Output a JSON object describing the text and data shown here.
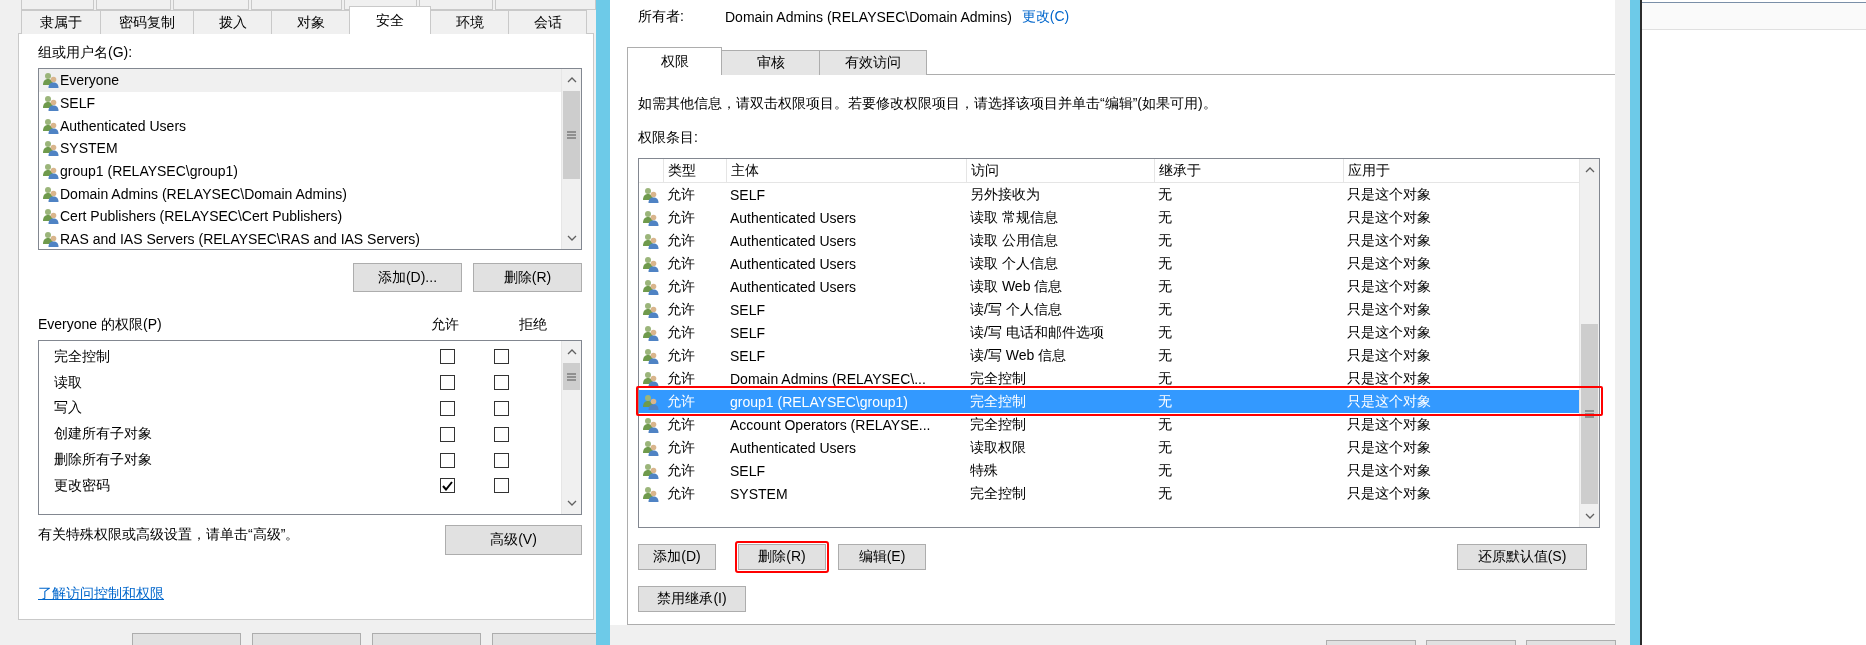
{
  "left_dialog": {
    "tabs": [
      {
        "label": "隶属于",
        "selected": false
      },
      {
        "label": "密码复制",
        "selected": false
      },
      {
        "label": "拨入",
        "selected": false
      },
      {
        "label": "对象",
        "selected": false
      },
      {
        "label": "安全",
        "selected": true
      },
      {
        "label": "环境",
        "selected": false
      },
      {
        "label": "会话",
        "selected": false
      }
    ],
    "group_label": "组或用户名(G):",
    "groups": [
      {
        "name": "Everyone",
        "selected": true
      },
      {
        "name": "SELF",
        "selected": false
      },
      {
        "name": "Authenticated Users",
        "selected": false
      },
      {
        "name": "SYSTEM",
        "selected": false
      },
      {
        "name": "group1 (RELAYSEC\\group1)",
        "selected": false
      },
      {
        "name": "Domain Admins (RELAYSEC\\Domain Admins)",
        "selected": false
      },
      {
        "name": "Cert Publishers (RELAYSEC\\Cert Publishers)",
        "selected": false
      },
      {
        "name": "RAS and IAS Servers (RELAYSEC\\RAS and IAS Servers)",
        "selected": false
      }
    ],
    "group_buttons": [
      "添加(D)...",
      "删除(R)"
    ],
    "permissions_label": "Everyone 的权限(P)",
    "allow_header": "允许",
    "deny_header": "拒绝",
    "permissions": [
      {
        "name": "完全控制",
        "allow": false,
        "deny": false
      },
      {
        "name": "读取",
        "allow": false,
        "deny": false
      },
      {
        "name": "写入",
        "allow": false,
        "deny": false
      },
      {
        "name": "创建所有子对象",
        "allow": false,
        "deny": false
      },
      {
        "name": "删除所有子对象",
        "allow": false,
        "deny": false
      },
      {
        "name": "更改密码",
        "allow": true,
        "deny": false
      }
    ],
    "advanced_hint": "有关特殊权限或高级设置，请单击“高级”。",
    "advanced_button": "高级(V)",
    "learn_link": "了解访问控制和权限"
  },
  "right_dialog": {
    "owner_label": "所有者:",
    "owner": "Domain Admins (RELAYSEC\\Domain Admins)",
    "change_link": "更改(C)",
    "tabs": [
      {
        "label": "权限",
        "selected": true
      },
      {
        "label": "审核",
        "selected": false
      },
      {
        "label": "有效访问",
        "selected": false
      }
    ],
    "info": "如需其他信息，请双击权限项目。若要修改权限项目，请选择该项目并单击“编辑”(如果可用)。",
    "entries_label": "权限条目:",
    "table": {
      "columns": [
        "类型",
        "主体",
        "访问",
        "继承于",
        "应用于"
      ],
      "rows": [
        {
          "type": "允许",
          "principal": "SELF",
          "access": "另外接收为",
          "inherited_from": "无",
          "applies_to": "只是这个对象",
          "selected": false,
          "annotated": false
        },
        {
          "type": "允许",
          "principal": "Authenticated Users",
          "access": "读取 常规信息",
          "inherited_from": "无",
          "applies_to": "只是这个对象",
          "selected": false,
          "annotated": false
        },
        {
          "type": "允许",
          "principal": "Authenticated Users",
          "access": "读取 公用信息",
          "inherited_from": "无",
          "applies_to": "只是这个对象",
          "selected": false,
          "annotated": false
        },
        {
          "type": "允许",
          "principal": "Authenticated Users",
          "access": "读取 个人信息",
          "inherited_from": "无",
          "applies_to": "只是这个对象",
          "selected": false,
          "annotated": false
        },
        {
          "type": "允许",
          "principal": "Authenticated Users",
          "access": "读取 Web 信息",
          "inherited_from": "无",
          "applies_to": "只是这个对象",
          "selected": false,
          "annotated": false
        },
        {
          "type": "允许",
          "principal": "SELF",
          "access": "读/写 个人信息",
          "inherited_from": "无",
          "applies_to": "只是这个对象",
          "selected": false,
          "annotated": false
        },
        {
          "type": "允许",
          "principal": "SELF",
          "access": "读/写 电话和邮件选项",
          "inherited_from": "无",
          "applies_to": "只是这个对象",
          "selected": false,
          "annotated": false
        },
        {
          "type": "允许",
          "principal": "SELF",
          "access": "读/写 Web 信息",
          "inherited_from": "无",
          "applies_to": "只是这个对象",
          "selected": false,
          "annotated": false
        },
        {
          "type": "允许",
          "principal": "Domain Admins (RELAYSEC\\...",
          "access": "完全控制",
          "inherited_from": "无",
          "applies_to": "只是这个对象",
          "selected": false,
          "annotated": false
        },
        {
          "type": "允许",
          "principal": "group1 (RELAYSEC\\group1)",
          "access": "完全控制",
          "inherited_from": "无",
          "applies_to": "只是这个对象",
          "selected": true,
          "annotated": true
        },
        {
          "type": "允许",
          "principal": "Account Operators (RELAYSE...",
          "access": "完全控制",
          "inherited_from": "无",
          "applies_to": "只是这个对象",
          "selected": false,
          "annotated": false
        },
        {
          "type": "允许",
          "principal": "Authenticated Users",
          "access": "读取权限",
          "inherited_from": "无",
          "applies_to": "只是这个对象",
          "selected": false,
          "annotated": false
        },
        {
          "type": "允许",
          "principal": "SELF",
          "access": "特殊",
          "inherited_from": "无",
          "applies_to": "只是这个对象",
          "selected": false,
          "annotated": false
        },
        {
          "type": "允许",
          "principal": "SYSTEM",
          "access": "完全控制",
          "inherited_from": "无",
          "applies_to": "只是这个对象",
          "selected": false,
          "annotated": false
        }
      ]
    },
    "buttons": [
      {
        "label": "添加(D)",
        "annotated": false
      },
      {
        "label": "删除(R)",
        "annotated": true
      },
      {
        "label": "编辑(E)",
        "annotated": false
      }
    ],
    "restore_button": "还原默认值(S)",
    "inherit_button": "禁用继承(I)"
  }
}
